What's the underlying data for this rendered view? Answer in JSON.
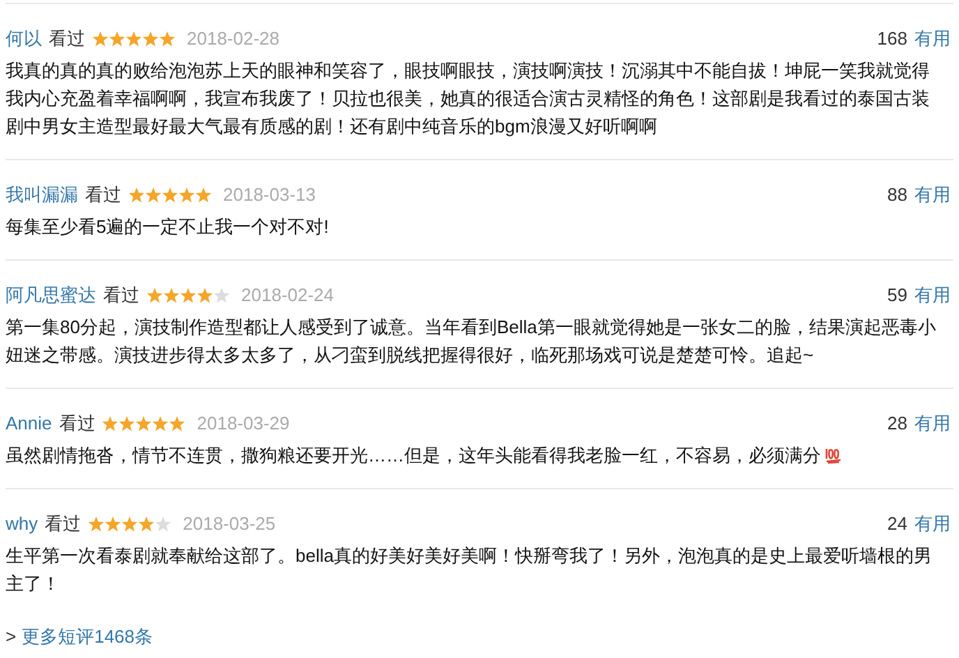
{
  "reviews": [
    {
      "user": "何以",
      "watched": "看过",
      "stars": 5,
      "date": "2018-02-28",
      "votes": "168",
      "useful": "有用",
      "text": "我真的真的真的败给泡泡苏上天的眼神和笑容了，眼技啊眼技，演技啊演技！沉溺其中不能自拔！坤屁一笑我就觉得我内心充盈着幸福啊啊，我宣布我废了！贝拉也很美，她真的很适合演古灵精怪的角色！这部剧是我看过的泰国古装剧中男女主造型最好最大气最有质感的剧！还有剧中纯音乐的bgm浪漫又好听啊啊",
      "emoji": false
    },
    {
      "user": "我叫漏漏",
      "watched": "看过",
      "stars": 5,
      "date": "2018-03-13",
      "votes": "88",
      "useful": "有用",
      "text": "每集至少看5遍的一定不止我一个对不对!",
      "emoji": false
    },
    {
      "user": "阿凡思蜜达",
      "watched": "看过",
      "stars": 4,
      "date": "2018-02-24",
      "votes": "59",
      "useful": "有用",
      "text": "第一集80分起，演技制作造型都让人感受到了诚意。当年看到Bella第一眼就觉得她是一张女二的脸，结果演起恶毒小妞迷之带感。演技进步得太多太多了，从刁蛮到脱线把握得很好，临死那场戏可说是楚楚可怜。追起~",
      "emoji": false
    },
    {
      "user": "Annie",
      "watched": "看过",
      "stars": 5,
      "date": "2018-03-29",
      "votes": "28",
      "useful": "有用",
      "text": "虽然剧情拖沓，情节不连贯，撒狗粮还要开光……但是，这年头能看得我老脸一红，不容易，必须满分",
      "emoji": true
    },
    {
      "user": "why",
      "watched": "看过",
      "stars": 4,
      "date": "2018-03-25",
      "votes": "24",
      "useful": "有用",
      "text": "生平第一次看泰剧就奉献给这部了。bella真的好美好美好美啊！快掰弯我了！另外，泡泡真的是史上最爱听墙根的男主了！",
      "emoji": false
    }
  ],
  "more": {
    "prefix": ">",
    "label": "更多短评1468条"
  }
}
